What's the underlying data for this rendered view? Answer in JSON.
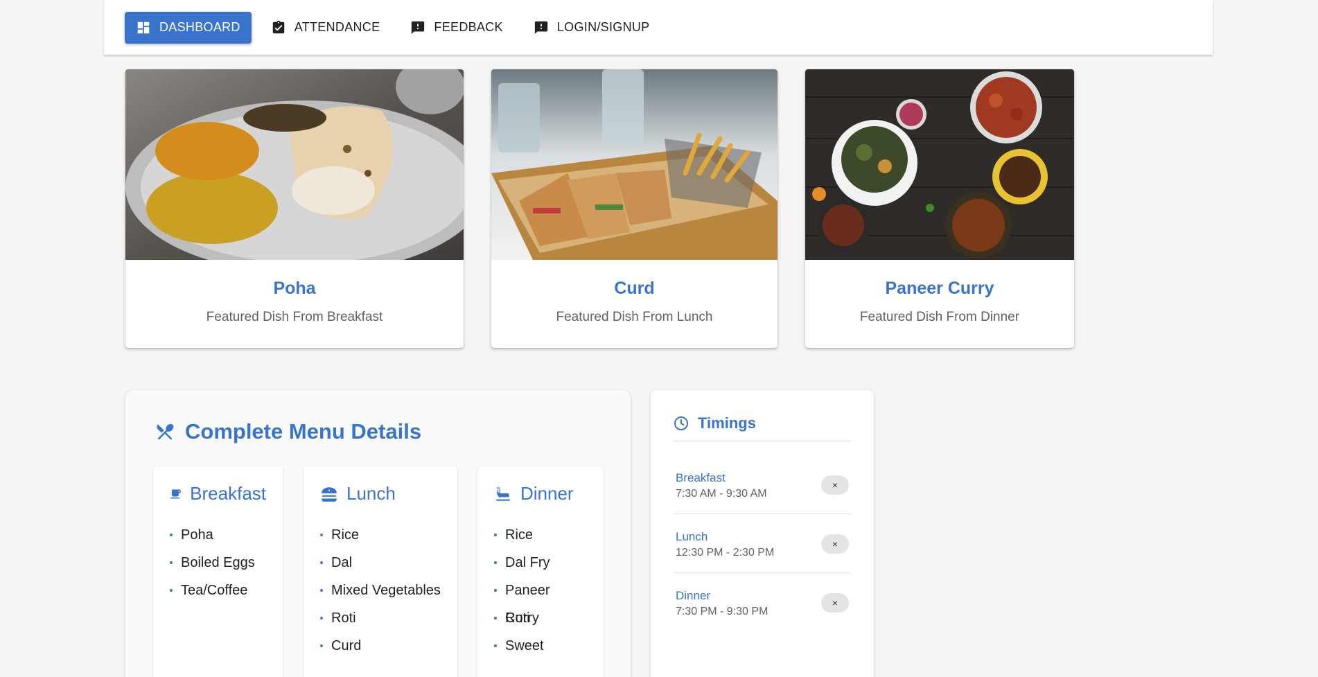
{
  "nav": {
    "items": [
      {
        "label": "DASHBOARD",
        "icon": "dashboard-icon",
        "active": true
      },
      {
        "label": "ATTENDANCE",
        "icon": "assignment-turned-in-icon",
        "active": false
      },
      {
        "label": "FEEDBACK",
        "icon": "feedback-icon",
        "active": false
      },
      {
        "label": "LOGIN/SIGNUP",
        "icon": "feedback-icon",
        "active": false
      }
    ]
  },
  "featured": [
    {
      "title": "Poha",
      "subtitle": "Featured Dish From Breakfast",
      "image": "thali-plate-photo"
    },
    {
      "title": "Curd",
      "subtitle": "Featured Dish From Lunch",
      "image": "sandwich-fries-tray-photo"
    },
    {
      "title": "Paneer Curry",
      "subtitle": "Featured Dish From Dinner",
      "image": "curry-bowls-photo"
    }
  ],
  "menu": {
    "title": "Complete Menu Details",
    "icon": "restaurant-icon",
    "columns": [
      {
        "label": "Breakfast",
        "icon": "coffee-icon",
        "items": [
          "Poha",
          "Boiled Eggs",
          "Tea/Coffee"
        ]
      },
      {
        "label": "Lunch",
        "icon": "lunch-dining-icon",
        "items": [
          "Rice",
          "Dal",
          "Mixed Vegetables",
          "Roti",
          "Curd"
        ]
      },
      {
        "label": "Dinner",
        "icon": "dinner-dining-icon",
        "items": [
          "Rice",
          "Dal Fry",
          "Paneer Curry",
          "Roti",
          "Sweet"
        ]
      }
    ]
  },
  "timings": {
    "title": "Timings",
    "icon": "clock-icon",
    "rows": [
      {
        "meal": "Breakfast",
        "time": "7:30 AM - 9:30 AM",
        "chip": "×"
      },
      {
        "meal": "Lunch",
        "time": "12:30 PM - 2:30 PM",
        "chip": "×"
      },
      {
        "meal": "Dinner",
        "time": "7:30 PM - 9:30 PM",
        "chip": "×"
      }
    ]
  },
  "colors": {
    "accent": "#3874cb",
    "background": "#f5f5f5",
    "text_secondary": "#616161"
  }
}
